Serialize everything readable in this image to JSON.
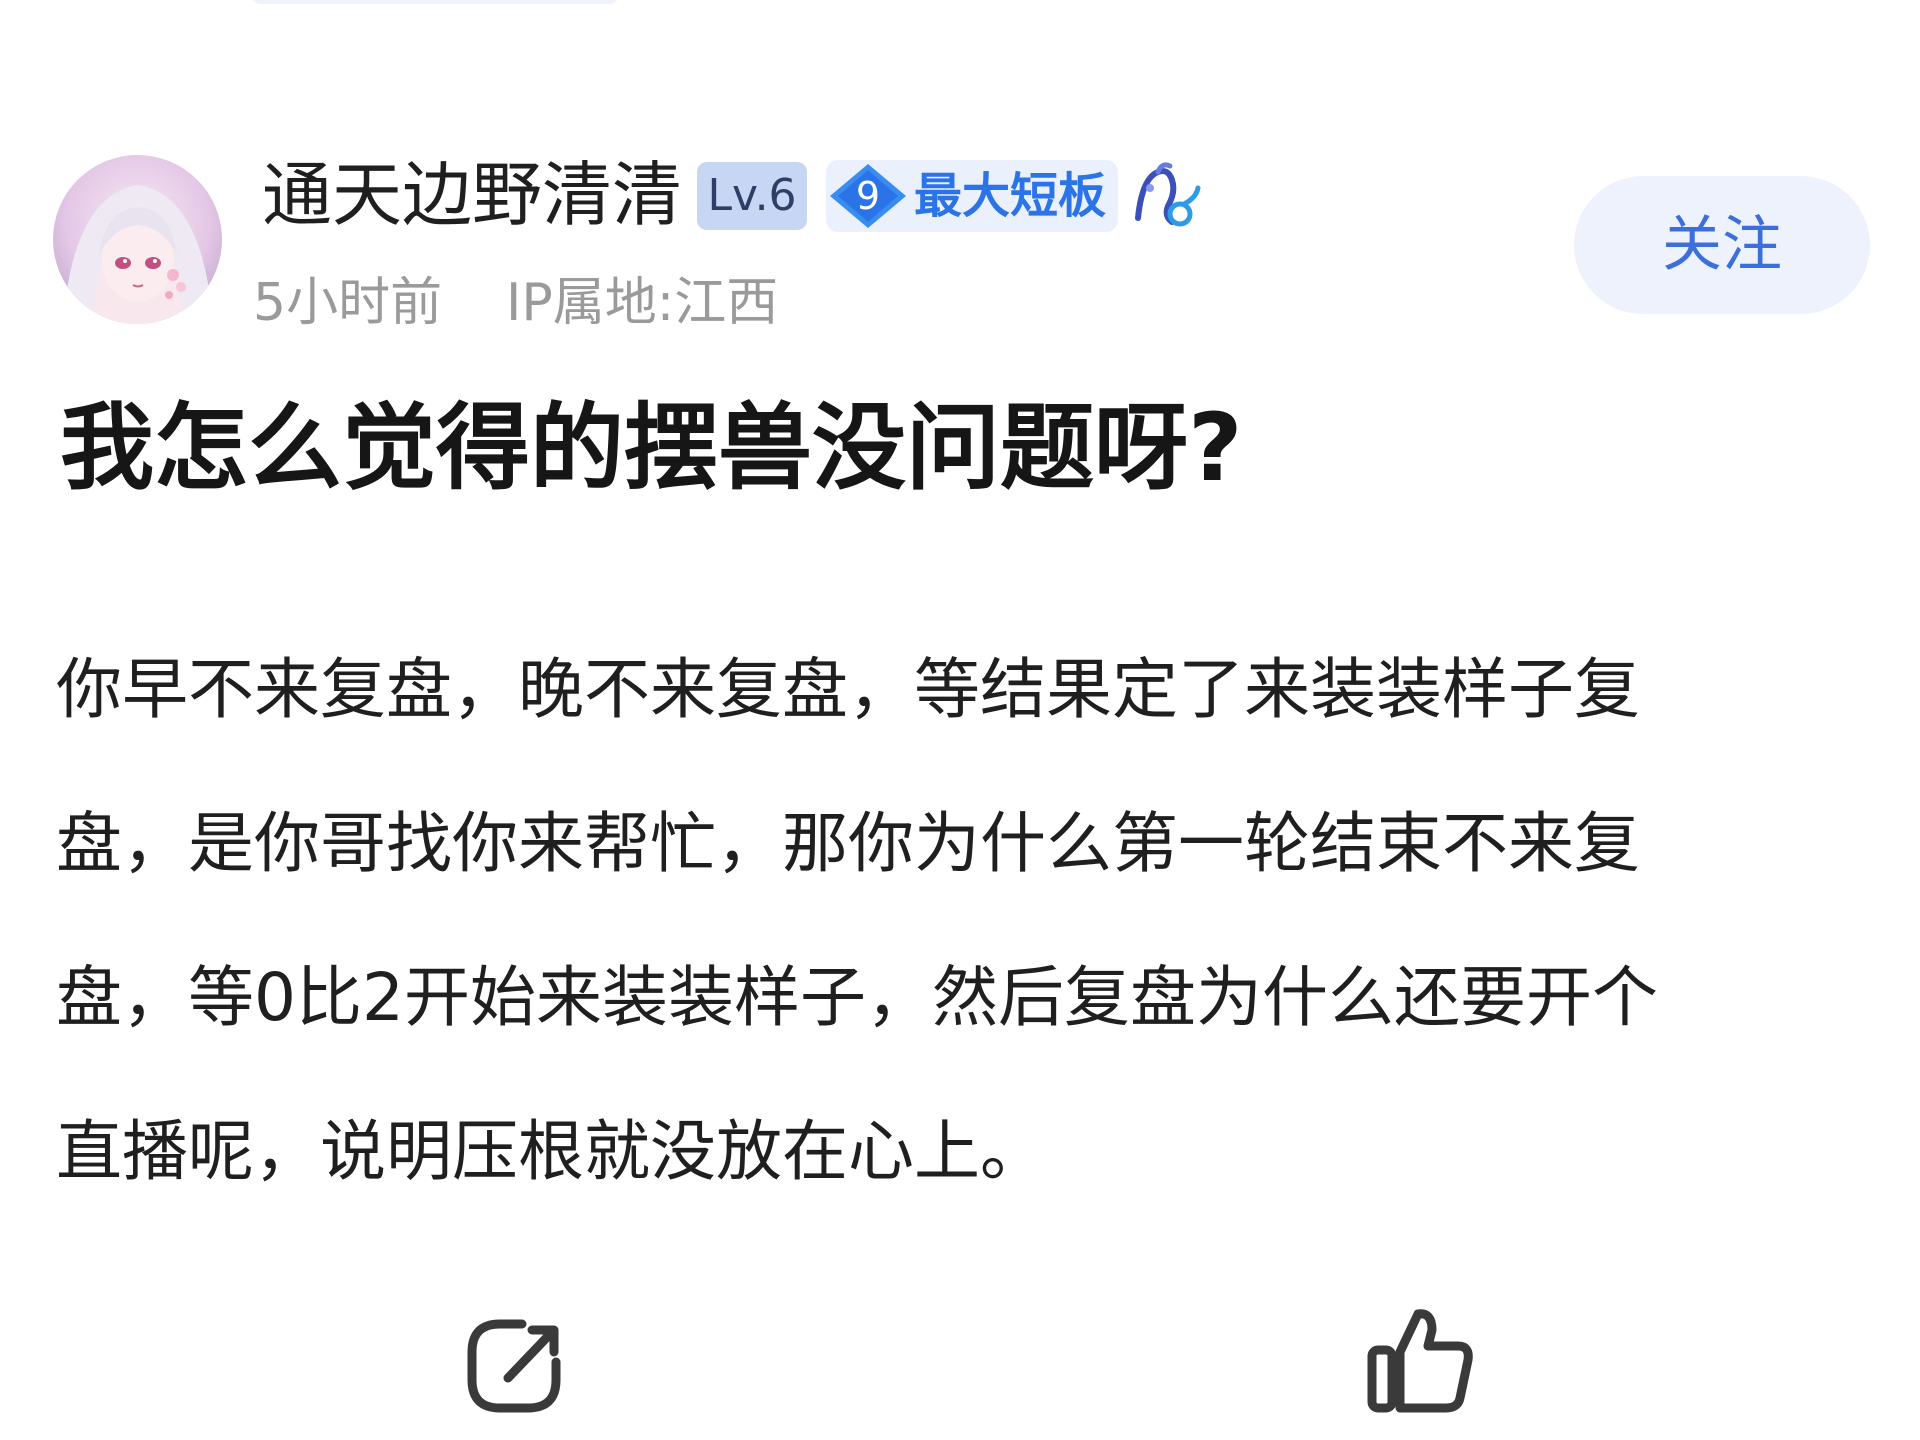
{
  "author": {
    "name": "通天边野清清",
    "level": "Lv.6",
    "rank_number": "9",
    "rank_title": "最大短板",
    "zodiac_icon": "capricorn-icon",
    "post_time": "5小时前",
    "ip_location": "IP属地:江西",
    "follow_label": "关注"
  },
  "post": {
    "title": "我怎么觉得的摆兽没问题呀?",
    "body_lines": [
      "你早不来复盘，晚不来复盘，等结果定了来装装样子复",
      "盘，是你哥找你来帮忙，那你为什么第一轮结束不来复",
      "盘，等0比2开始来装装样子，然后复盘为什么还要开个",
      "直播呢，说明压根就没放在心上。"
    ]
  },
  "actions": {
    "share_icon": "share-icon",
    "like_icon": "thumbs-up-icon"
  },
  "colors": {
    "follow_text": "#3d6fdc",
    "follow_bg": "#eef2fc",
    "rank_blue": "#2b74e8",
    "level_bg": "#c7d6f2",
    "meta_gray": "#9a9a9a"
  }
}
